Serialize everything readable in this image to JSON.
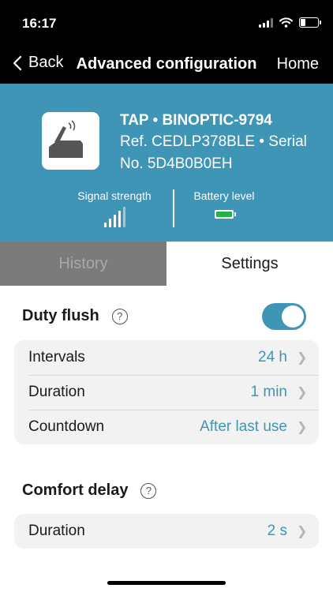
{
  "status_bar": {
    "time": "16:17"
  },
  "nav": {
    "back_label": "Back",
    "title": "Advanced configuration",
    "home_label": "Home"
  },
  "device": {
    "name": "TAP • BINOPTIC-9794",
    "reference": "Ref. CEDLP378BLE • Serial No. 5D4B0B0EH",
    "signal_label": "Signal strength",
    "battery_label": "Battery level",
    "accent_color": "#3f95b6",
    "battery_color": "#22b14c"
  },
  "tabs": [
    {
      "label": "History",
      "active": false
    },
    {
      "label": "Settings",
      "active": true
    }
  ],
  "duty_flush": {
    "title": "Duty flush",
    "help_symbol": "?",
    "enabled": true,
    "rows": [
      {
        "label": "Intervals",
        "value": "24 h"
      },
      {
        "label": "Duration",
        "value": "1 min"
      },
      {
        "label": "Countdown",
        "value": "After last use"
      }
    ]
  },
  "comfort_delay": {
    "title": "Comfort delay",
    "help_symbol": "?",
    "rows": [
      {
        "label": "Duration",
        "value": "2 s"
      }
    ]
  }
}
